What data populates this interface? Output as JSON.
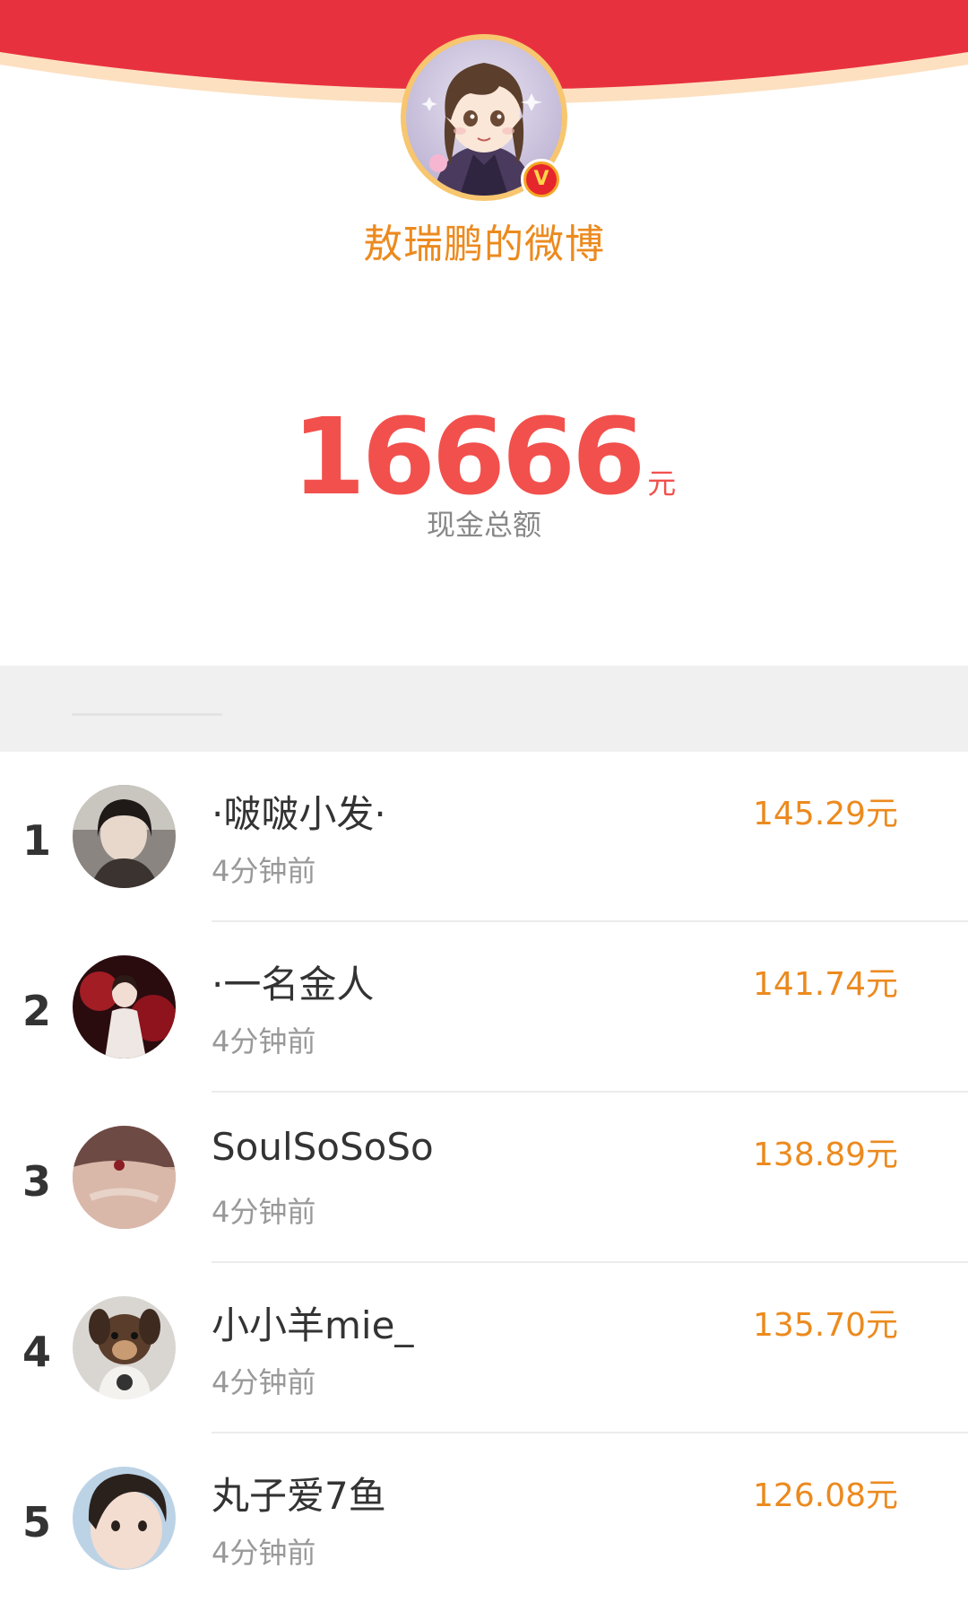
{
  "header": {
    "account_name": "敖瑞鹏的微博",
    "avatar_icon": "cartoon-avatar-icon",
    "badge_icon": "verified-v-icon",
    "badge_glyph": "V"
  },
  "summary": {
    "total_amount": "16666",
    "unit": "元",
    "caption": "现金总额"
  },
  "ranking": [
    {
      "rank": "1",
      "name": "·啵啵小发·",
      "time": "4分钟前",
      "amount": "145.29元"
    },
    {
      "rank": "2",
      "name": "·一名金人",
      "time": "4分钟前",
      "amount": "141.74元"
    },
    {
      "rank": "3",
      "name": "SoulSoSoSo",
      "time": "4分钟前",
      "amount": "138.89元"
    },
    {
      "rank": "4",
      "name": "小小羊mie_",
      "time": "4分钟前",
      "amount": "135.70元"
    },
    {
      "rank": "5",
      "name": "丸子爱7鱼",
      "time": "4分钟前",
      "amount": "126.08元"
    }
  ],
  "colors": {
    "banner_red": "#e8313f",
    "banner_rim": "#fde0c0",
    "amount_red": "#f2504c",
    "accent_orange": "#ec8a1e"
  }
}
